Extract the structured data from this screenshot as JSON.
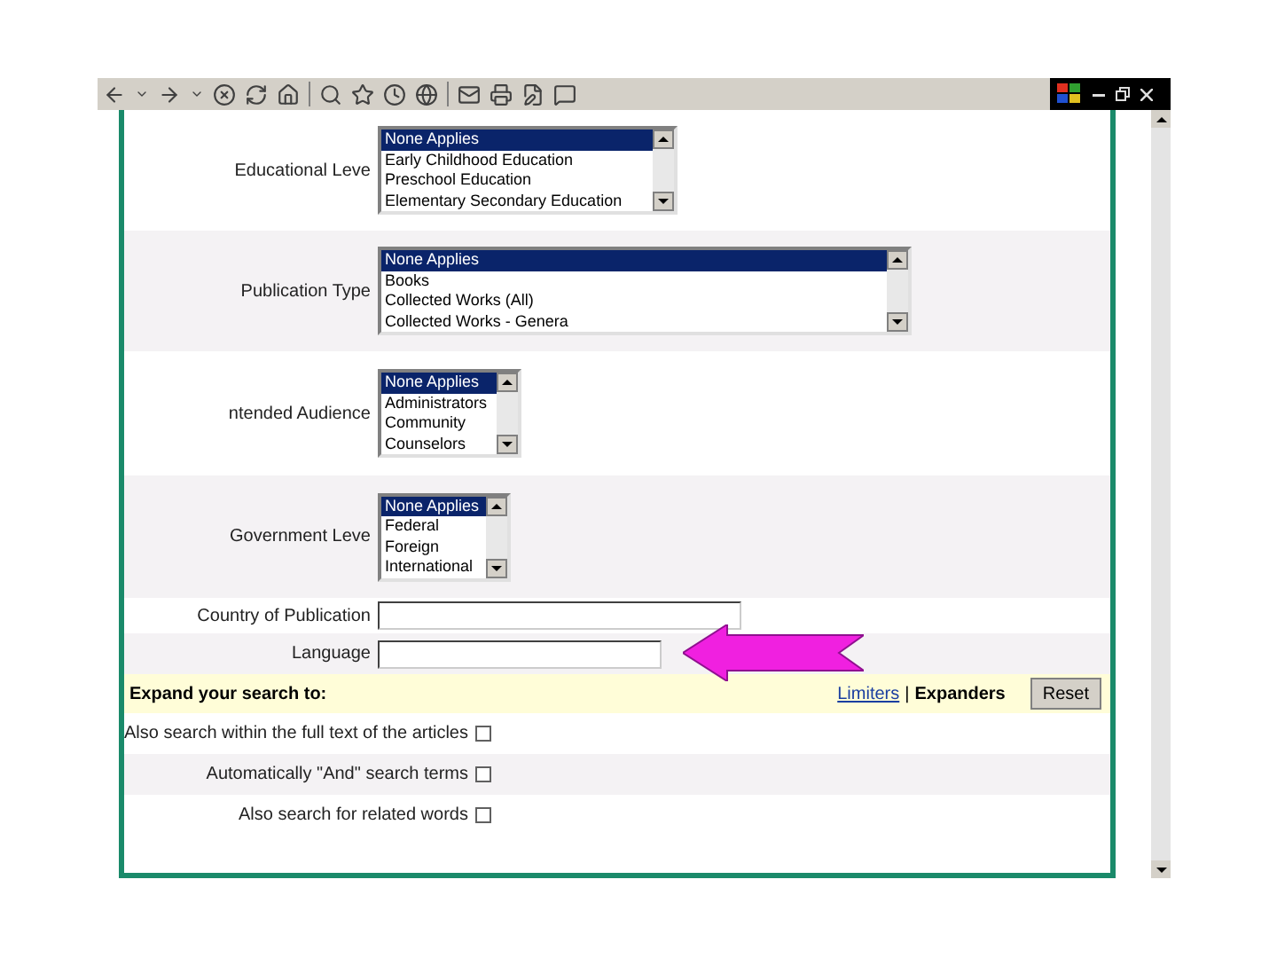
{
  "filters": [
    {
      "label": "Educational Leve",
      "options": [
        {
          "text": "None Applies",
          "selected": true
        },
        {
          "text": "Early Childhood Education",
          "selected": false
        },
        {
          "text": "Preschool Education",
          "selected": false
        },
        {
          "text": "Elementary Secondary Education",
          "selected": false
        }
      ]
    },
    {
      "label": "Publication Type",
      "options": [
        {
          "text": "None Applies",
          "selected": true
        },
        {
          "text": "Books",
          "selected": false
        },
        {
          "text": "Collected Works (All)",
          "selected": false
        },
        {
          "text": "Collected Works - Genera",
          "selected": false
        }
      ]
    },
    {
      "label": "ntended Audience",
      "options": [
        {
          "text": "None Applies",
          "selected": true
        },
        {
          "text": "Administrators",
          "selected": false
        },
        {
          "text": "Community",
          "selected": false
        },
        {
          "text": "Counselors",
          "selected": false
        }
      ]
    },
    {
      "label": "Government Leve",
      "options": [
        {
          "text": "None Applies",
          "selected": true
        },
        {
          "text": "Federal",
          "selected": false
        },
        {
          "text": "Foreign",
          "selected": false
        },
        {
          "text": "International",
          "selected": false
        }
      ]
    }
  ],
  "text_fields": [
    {
      "label": "Country of Publication"
    },
    {
      "label": "Language"
    }
  ],
  "expand_bar": {
    "title": "Expand your search to:",
    "limiters_link": "Limiters",
    "separator": "|",
    "expanders": "Expanders",
    "reset_button": "Reset"
  },
  "options": [
    {
      "label": "Also search within the full text of the articles",
      "checked": false
    },
    {
      "label": "Automatically \"And\" search terms",
      "checked": false
    },
    {
      "label": "Also search for related words",
      "checked": false
    }
  ]
}
